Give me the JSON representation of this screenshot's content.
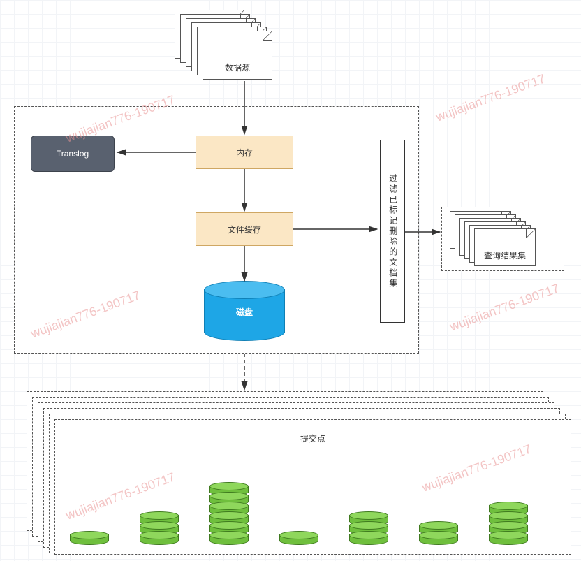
{
  "nodes": {
    "datasource": "数据源",
    "translog": "Translog",
    "memory": "内存",
    "filecache": "文件缓存",
    "disk": "磁盘",
    "filter": "过滤已标记删除的文档集",
    "result": "查询结果集",
    "commit": "提交点"
  },
  "watermark": "wujiajian776-190717",
  "commit_stacks": [
    1,
    3,
    6,
    1,
    3,
    2,
    4
  ],
  "doc_stack_depth": 6
}
